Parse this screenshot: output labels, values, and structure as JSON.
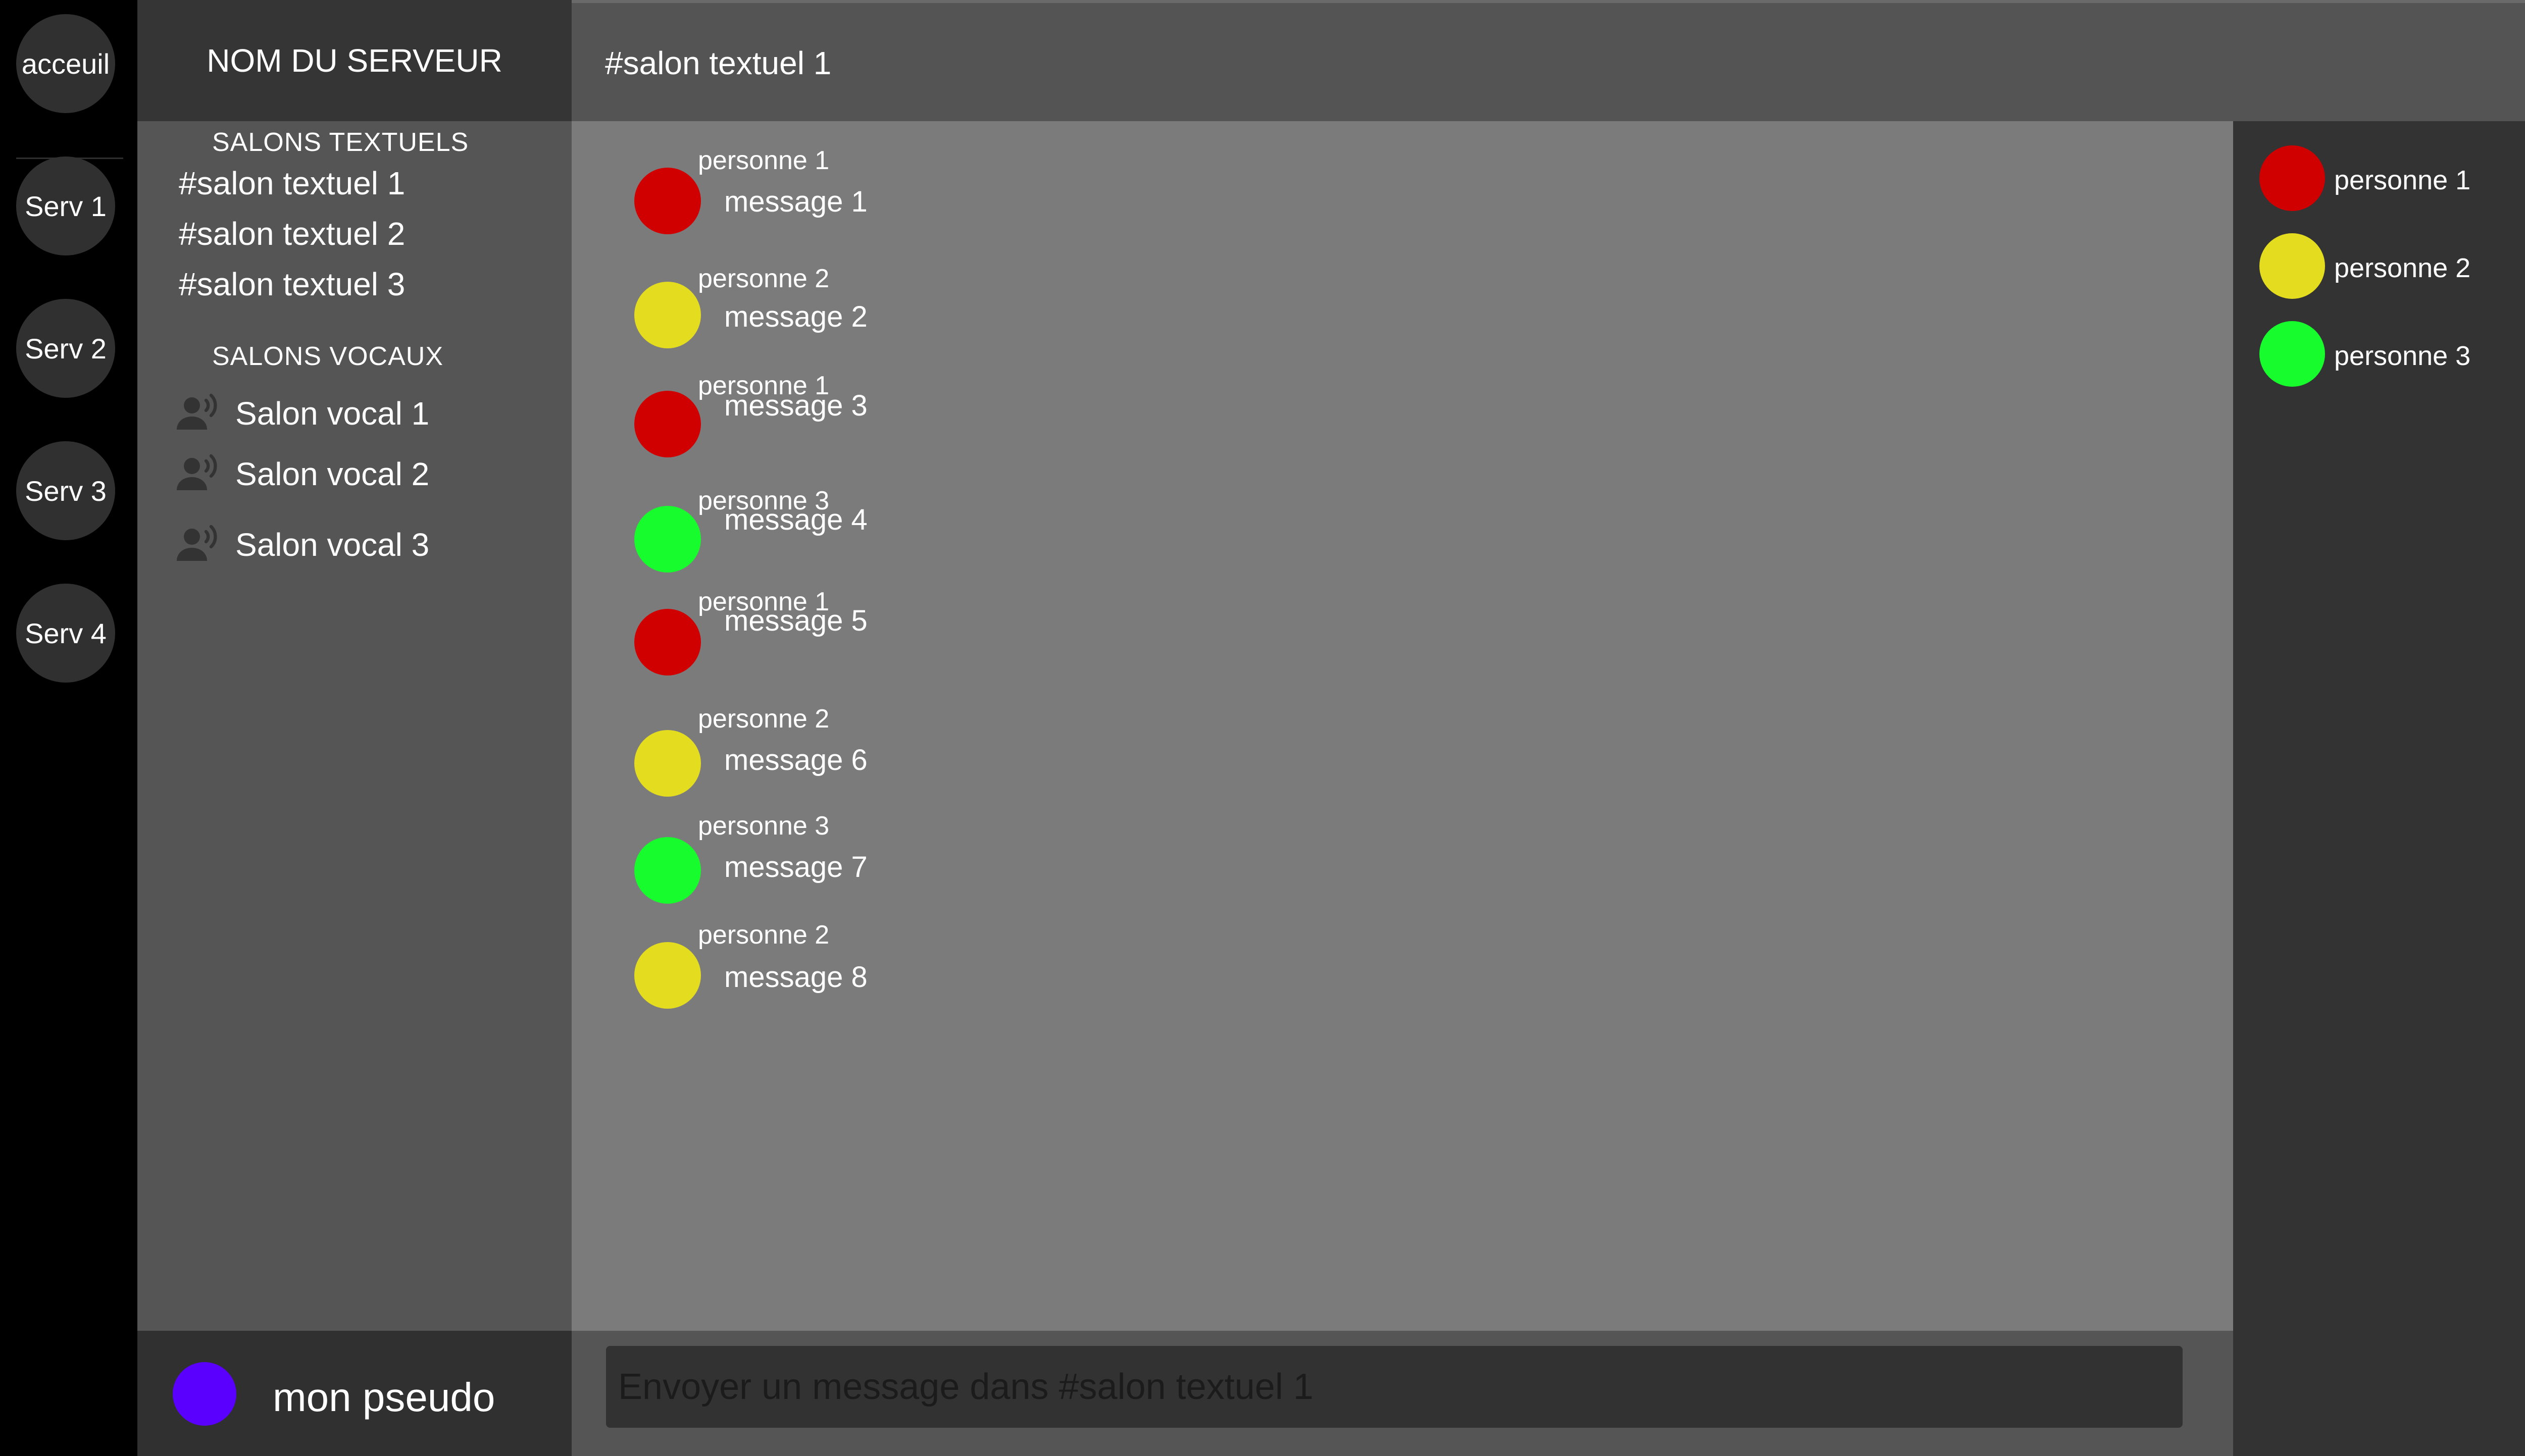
{
  "servers": {
    "home_label": "acceuil",
    "items": [
      {
        "label": "Serv 1"
      },
      {
        "label": "Serv 2"
      },
      {
        "label": "Serv 3"
      },
      {
        "label": "Serv 4"
      }
    ]
  },
  "sidebar": {
    "server_name": "NOM DU SERVEUR",
    "text_section_title": "SALONS TEXTUELS",
    "text_channels": [
      {
        "label": "#salon textuel 1"
      },
      {
        "label": "#salon textuel 2"
      },
      {
        "label": "#salon textuel 3"
      }
    ],
    "voice_section_title": "SALONS VOCAUX",
    "voice_channels": [
      {
        "label": "Salon vocal 1",
        "icon": "voice-user-icon"
      },
      {
        "label": "Salon vocal 2",
        "icon": "voice-user-icon"
      },
      {
        "label": "Salon vocal 3",
        "icon": "voice-user-icon"
      }
    ]
  },
  "user_panel": {
    "username": "mon pseudo",
    "avatar_color": "#5a00ff"
  },
  "header": {
    "channel_title": "#salon textuel 1"
  },
  "messages": [
    {
      "author": "personne 1",
      "text": "message 1",
      "color": "#d10000"
    },
    {
      "author": "personne 2",
      "text": "message 2",
      "color": "#e4dd1f"
    },
    {
      "author": "personne 1",
      "text": "message 3",
      "color": "#d10000"
    },
    {
      "author": "personne 3",
      "text": "message 4",
      "color": "#17fc2c"
    },
    {
      "author": "personne 1",
      "text": "message 5",
      "color": "#d10000"
    },
    {
      "author": "personne 2",
      "text": "message 6",
      "color": "#e4dd1f"
    },
    {
      "author": "personne 3",
      "text": "message 7",
      "color": "#17fc2c"
    },
    {
      "author": "personne 2",
      "text": "message 8",
      "color": "#e4dd1f"
    }
  ],
  "composer": {
    "placeholder": "Envoyer un message dans #salon textuel 1"
  },
  "members": [
    {
      "name": "personne 1",
      "color": "#d10000"
    },
    {
      "name": "personne 2",
      "color": "#e4dd1f"
    },
    {
      "name": "personne 3",
      "color": "#17fc2c"
    }
  ],
  "colors": {
    "person_1": "#d10000",
    "person_2": "#e4dd1f",
    "person_3": "#17fc2c",
    "self": "#5a00ff"
  }
}
